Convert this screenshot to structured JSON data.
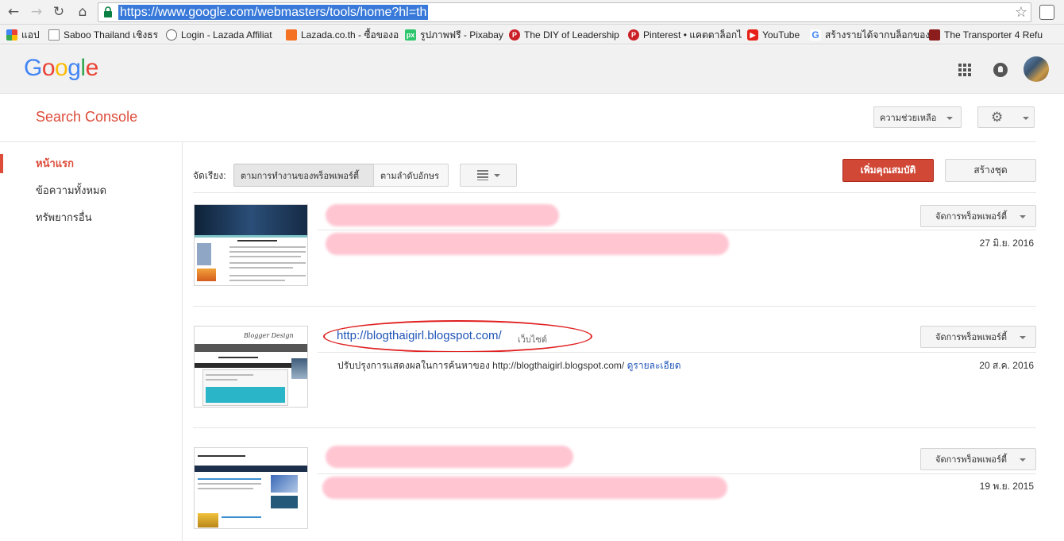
{
  "browser": {
    "url": "https://www.google.com/webmasters/tools/home?hl=th",
    "bookmarks": [
      {
        "label": "แอป",
        "icon": "apps-grid-icon"
      },
      {
        "label": "Saboo Thailand เชิงธร",
        "icon": "page-icon"
      },
      {
        "label": "Login - Lazada Affiliat",
        "icon": "lazada-affiliate-icon"
      },
      {
        "label": "Lazada.co.th - ซื้อของอ",
        "icon": "lazada-icon"
      },
      {
        "label": "รูปภาพฟรี - Pixabay",
        "icon": "pixabay-icon"
      },
      {
        "label": "The DIY of Leadership",
        "icon": "pinterest-icon"
      },
      {
        "label": "Pinterest • แคตตาล็อกไ",
        "icon": "pinterest-icon"
      },
      {
        "label": "YouTube",
        "icon": "youtube-icon"
      },
      {
        "label": "สร้างรายได้จากบล็อกของ",
        "icon": "google-icon"
      },
      {
        "label": "The Transporter 4 Refu",
        "icon": "movie-icon"
      }
    ]
  },
  "google": {
    "logo": "Google"
  },
  "console": {
    "title": "Search Console",
    "help_label": "ความช่วยเหลือ"
  },
  "sidebar": {
    "items": [
      {
        "label": "หน้าแรก",
        "active": true
      },
      {
        "label": "ข้อความทั้งหมด",
        "active": false
      },
      {
        "label": "ทรัพยากรอื่น",
        "active": false
      }
    ]
  },
  "sort": {
    "label": "จัดเรียง:",
    "by_performance": "ตามการทำงานของพร็อพเพอร์ตี้",
    "by_alpha": "ตามลำดับอักษร"
  },
  "actions": {
    "add_property": "เพิ่มคุณสมบัติ",
    "create_set": "สร้างชุด"
  },
  "properties": [
    {
      "manage_label": "จัดการพร็อพเพอร์ตี้",
      "date": "27 มิ.ย. 2016"
    },
    {
      "url": "http://blogthaigirl.blogspot.com/",
      "type": "เว็บไซต์",
      "message": "ปรับปรุงการแสดงผลในการค้นหาของ http://blogthaigirl.blogspot.com/",
      "details_link": "ดูรายละเอียด",
      "manage_label": "จัดการพร็อพเพอร์ตี้",
      "date": "20 ส.ค. 2016"
    },
    {
      "manage_label": "จัดการพร็อพเพอร์ตี้",
      "date": "19 พ.ย. 2015"
    }
  ],
  "colors": {
    "brand_red": "#dd4b39",
    "link_blue": "#1f54b8",
    "add_button": "#d14836"
  }
}
